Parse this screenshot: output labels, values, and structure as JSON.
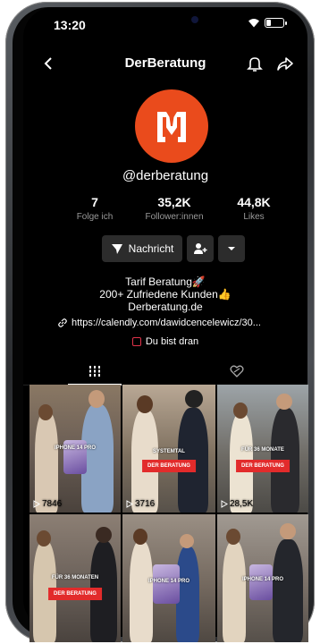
{
  "status_bar": {
    "time": "13:20"
  },
  "header": {
    "title": "DerBeratung"
  },
  "profile": {
    "handle": "@derberatung",
    "stats": [
      {
        "value": "7",
        "label": "Folge ich"
      },
      {
        "value": "35,2K",
        "label": "Follower:innen"
      },
      {
        "value": "44,8K",
        "label": "Likes"
      }
    ],
    "message_label": "Nachricht",
    "bio": [
      "Tarif Beratung🚀",
      "200+ Zufriedene Kunden👍",
      "Derberatung.de"
    ],
    "link": "https://calendly.com/dawidcencelewicz/30...",
    "promo": "Du bist dran"
  },
  "videos": [
    {
      "caption": "IPHONE 14 PRO",
      "tag": "",
      "views": "7846"
    },
    {
      "caption": "SYSTEMTAL",
      "tag": "DER BERATUNG",
      "views": "3716"
    },
    {
      "caption": "FÜR 36 MONATE",
      "tag": "DER BERATUNG",
      "views": "28,5K"
    },
    {
      "caption": "FÜR 36 MONATEN",
      "tag": "DER BERATUNG",
      "views": ""
    },
    {
      "caption": "IPHONE 14 PRO",
      "tag": "",
      "views": ""
    },
    {
      "caption": "IPHONE 14 PRO",
      "tag": "",
      "views": ""
    }
  ],
  "colors": {
    "brand": "#ea4b1c",
    "tag_red": "#e22b2b",
    "background": "#000000"
  },
  "icons": [
    "back-icon",
    "bell-icon",
    "share-icon",
    "send-icon",
    "add-friend-icon",
    "dropdown-icon",
    "link-icon",
    "grid-icon",
    "liked-icon",
    "play-icon"
  ]
}
